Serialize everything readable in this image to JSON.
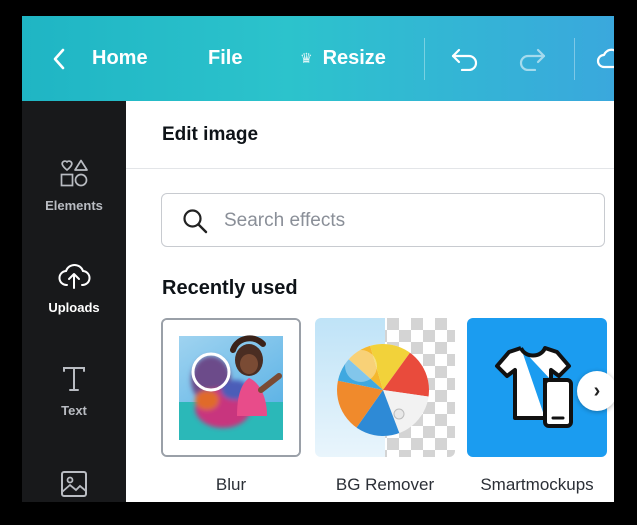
{
  "toolbar": {
    "home_label": "Home",
    "file_label": "File",
    "resize_label": "Resize"
  },
  "sidebar": {
    "items": [
      {
        "label": "Elements",
        "icon": "elements-icon"
      },
      {
        "label": "Uploads",
        "icon": "upload-cloud-icon"
      },
      {
        "label": "Text",
        "icon": "text-icon"
      },
      {
        "label": "",
        "icon": "photos-icon"
      }
    ]
  },
  "panel": {
    "title": "Edit image",
    "search_placeholder": "Search effects",
    "section_title": "Recently used",
    "effects": [
      {
        "label": "Blur"
      },
      {
        "label": "BG Remover"
      },
      {
        "label": "Smartmockups"
      }
    ]
  },
  "colors": {
    "toolbar_start": "#1fb5c4",
    "toolbar_end": "#3aa8dd",
    "sidebar_bg": "#18191b",
    "smartmockups_bg": "#1b9cf0"
  }
}
